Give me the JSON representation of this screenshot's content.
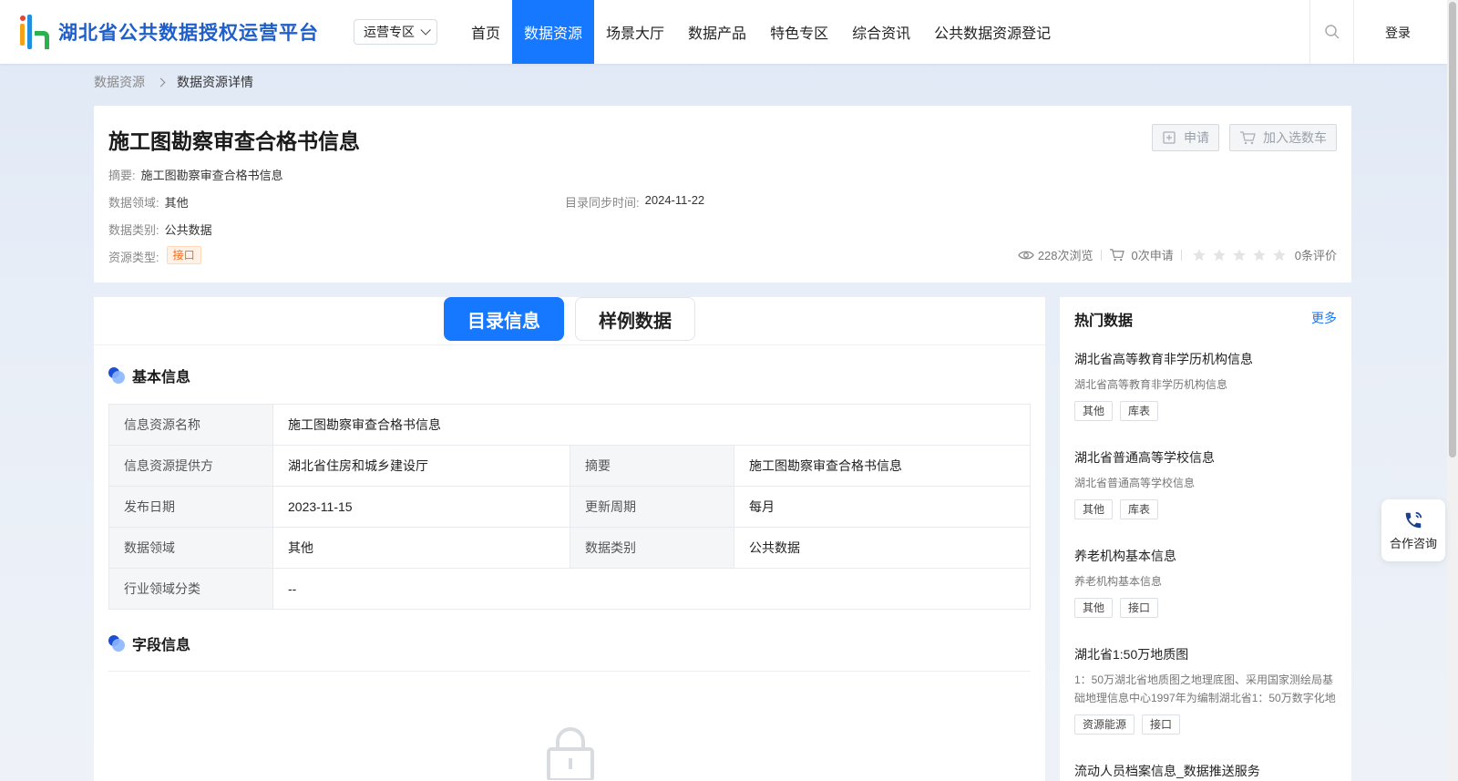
{
  "header": {
    "site_title": "湖北省公共数据授权运营平台",
    "region_select": "运营专区",
    "nav": [
      "首页",
      "数据资源",
      "场景大厅",
      "数据产品",
      "特色专区",
      "综合资讯",
      "公共数据资源登记"
    ],
    "active_nav": "数据资源",
    "login": "登录",
    "accent": "#1677ff"
  },
  "breadcrumb": {
    "parent": "数据资源",
    "current": "数据资源详情"
  },
  "detail": {
    "title": "施工图勘察审查合格书信息",
    "summary_label": "摘要:",
    "summary": "施工图勘察审查合格书信息",
    "domain_label": "数据领域:",
    "domain": "其他",
    "sync_label": "目录同步时间:",
    "sync_time": "2024-11-22",
    "category_label": "数据类别:",
    "category": "公共数据",
    "type_label": "资源类型:",
    "type": "接口",
    "apply_btn": "申请",
    "cart_btn": "加入选数车",
    "views": "228次浏览",
    "applies": "0次申请",
    "reviews": "0条评价",
    "rating": 0
  },
  "tabs": {
    "catalog": "目录信息",
    "sample": "样例数据"
  },
  "basic_info": {
    "heading": "基本信息",
    "rows": [
      {
        "k1": "信息资源名称",
        "v1": "施工图勘察审查合格书信息"
      },
      {
        "k1": "信息资源提供方",
        "v1": "湖北省住房和城乡建设厅",
        "k2": "摘要",
        "v2": "施工图勘察审查合格书信息"
      },
      {
        "k1": "发布日期",
        "v1": "2023-11-15",
        "k2": "更新周期",
        "v2": "每月"
      },
      {
        "k1": "数据领域",
        "v1": "其他",
        "k2": "数据类别",
        "v2": "公共数据"
      },
      {
        "k1": "行业领域分类",
        "v1": "--"
      }
    ]
  },
  "field_info": {
    "heading": "字段信息"
  },
  "hot": {
    "title": "热门数据",
    "more": "更多",
    "items": [
      {
        "name": "湖北省高等教育非学历机构信息",
        "desc": "湖北省高等教育非学历机构信息",
        "tags": [
          "其他",
          "库表"
        ]
      },
      {
        "name": "湖北省普通高等学校信息",
        "desc": "湖北省普通高等学校信息",
        "tags": [
          "其他",
          "库表"
        ]
      },
      {
        "name": "养老机构基本信息",
        "desc": "养老机构基本信息",
        "tags": [
          "其他",
          "接口"
        ]
      },
      {
        "name": "湖北省1:50万地质图",
        "desc": "1：50万湖北省地质图之地理底图、采用国家测绘局基础地理信息中心1997年为编制湖北省1：50万数字化地",
        "tags": [
          "资源能源",
          "接口"
        ]
      },
      {
        "name": "流动人员档案信息_数据推送服务",
        "desc": "",
        "tags": []
      }
    ]
  },
  "consult": {
    "label": "合作咨询"
  }
}
